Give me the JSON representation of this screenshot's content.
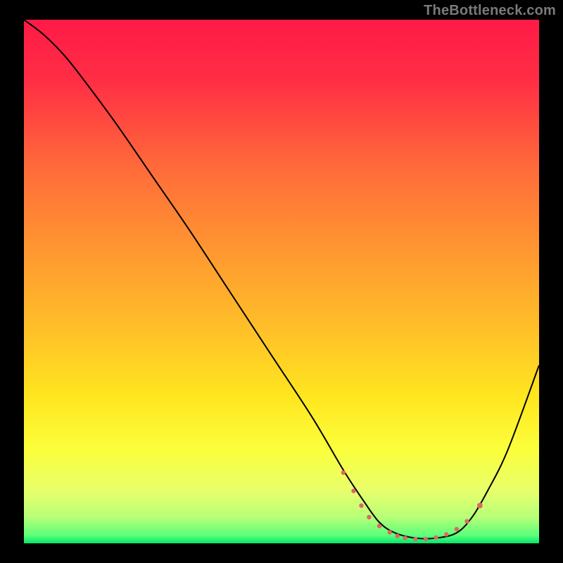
{
  "watermark": "TheBottleneck.com",
  "chart_data": {
    "type": "line",
    "title": "",
    "xlabel": "",
    "ylabel": "",
    "xlim": [
      0,
      100
    ],
    "ylim": [
      0,
      100
    ],
    "background_gradient_stops": [
      {
        "offset": 0.0,
        "color": "#ff1a47"
      },
      {
        "offset": 0.12,
        "color": "#ff2f44"
      },
      {
        "offset": 0.28,
        "color": "#ff6a3a"
      },
      {
        "offset": 0.45,
        "color": "#ff9a30"
      },
      {
        "offset": 0.6,
        "color": "#ffc228"
      },
      {
        "offset": 0.72,
        "color": "#ffe61f"
      },
      {
        "offset": 0.82,
        "color": "#fbff3b"
      },
      {
        "offset": 0.9,
        "color": "#e8ff6c"
      },
      {
        "offset": 0.95,
        "color": "#b7ff77"
      },
      {
        "offset": 0.985,
        "color": "#5cff7a"
      },
      {
        "offset": 1.0,
        "color": "#00e86b"
      }
    ],
    "series": [
      {
        "name": "bottleneck-curve",
        "color": "#000000",
        "x": [
          0,
          4,
          8,
          12,
          18,
          25,
          32,
          40,
          48,
          56,
          62,
          66,
          69,
          72,
          76,
          80,
          84,
          87,
          90,
          94,
          100
        ],
        "y": [
          100,
          97,
          93,
          88,
          80,
          70,
          60,
          48,
          36,
          24,
          14,
          8,
          4,
          2,
          1,
          1,
          2,
          5,
          10,
          18,
          34
        ]
      }
    ],
    "markers": {
      "name": "optimal-range",
      "color": "#e06666",
      "radius_small": 3.2,
      "radius_large": 3.9,
      "points": [
        {
          "x": 62.0,
          "y": 13.5,
          "r": "small"
        },
        {
          "x": 64.0,
          "y": 10.0,
          "r": "small"
        },
        {
          "x": 65.5,
          "y": 7.2,
          "r": "small"
        },
        {
          "x": 67.0,
          "y": 5.0,
          "r": "small"
        },
        {
          "x": 69.0,
          "y": 3.3,
          "r": "small"
        },
        {
          "x": 71.0,
          "y": 2.1,
          "r": "small"
        },
        {
          "x": 72.5,
          "y": 1.4,
          "r": "small"
        },
        {
          "x": 74.0,
          "y": 1.0,
          "r": "small"
        },
        {
          "x": 76.0,
          "y": 0.8,
          "r": "small"
        },
        {
          "x": 78.0,
          "y": 0.8,
          "r": "small"
        },
        {
          "x": 80.0,
          "y": 1.1,
          "r": "small"
        },
        {
          "x": 82.0,
          "y": 1.7,
          "r": "small"
        },
        {
          "x": 84.0,
          "y": 2.7,
          "r": "small"
        },
        {
          "x": 86.0,
          "y": 4.2,
          "r": "small"
        },
        {
          "x": 88.5,
          "y": 7.2,
          "r": "large"
        }
      ]
    }
  }
}
